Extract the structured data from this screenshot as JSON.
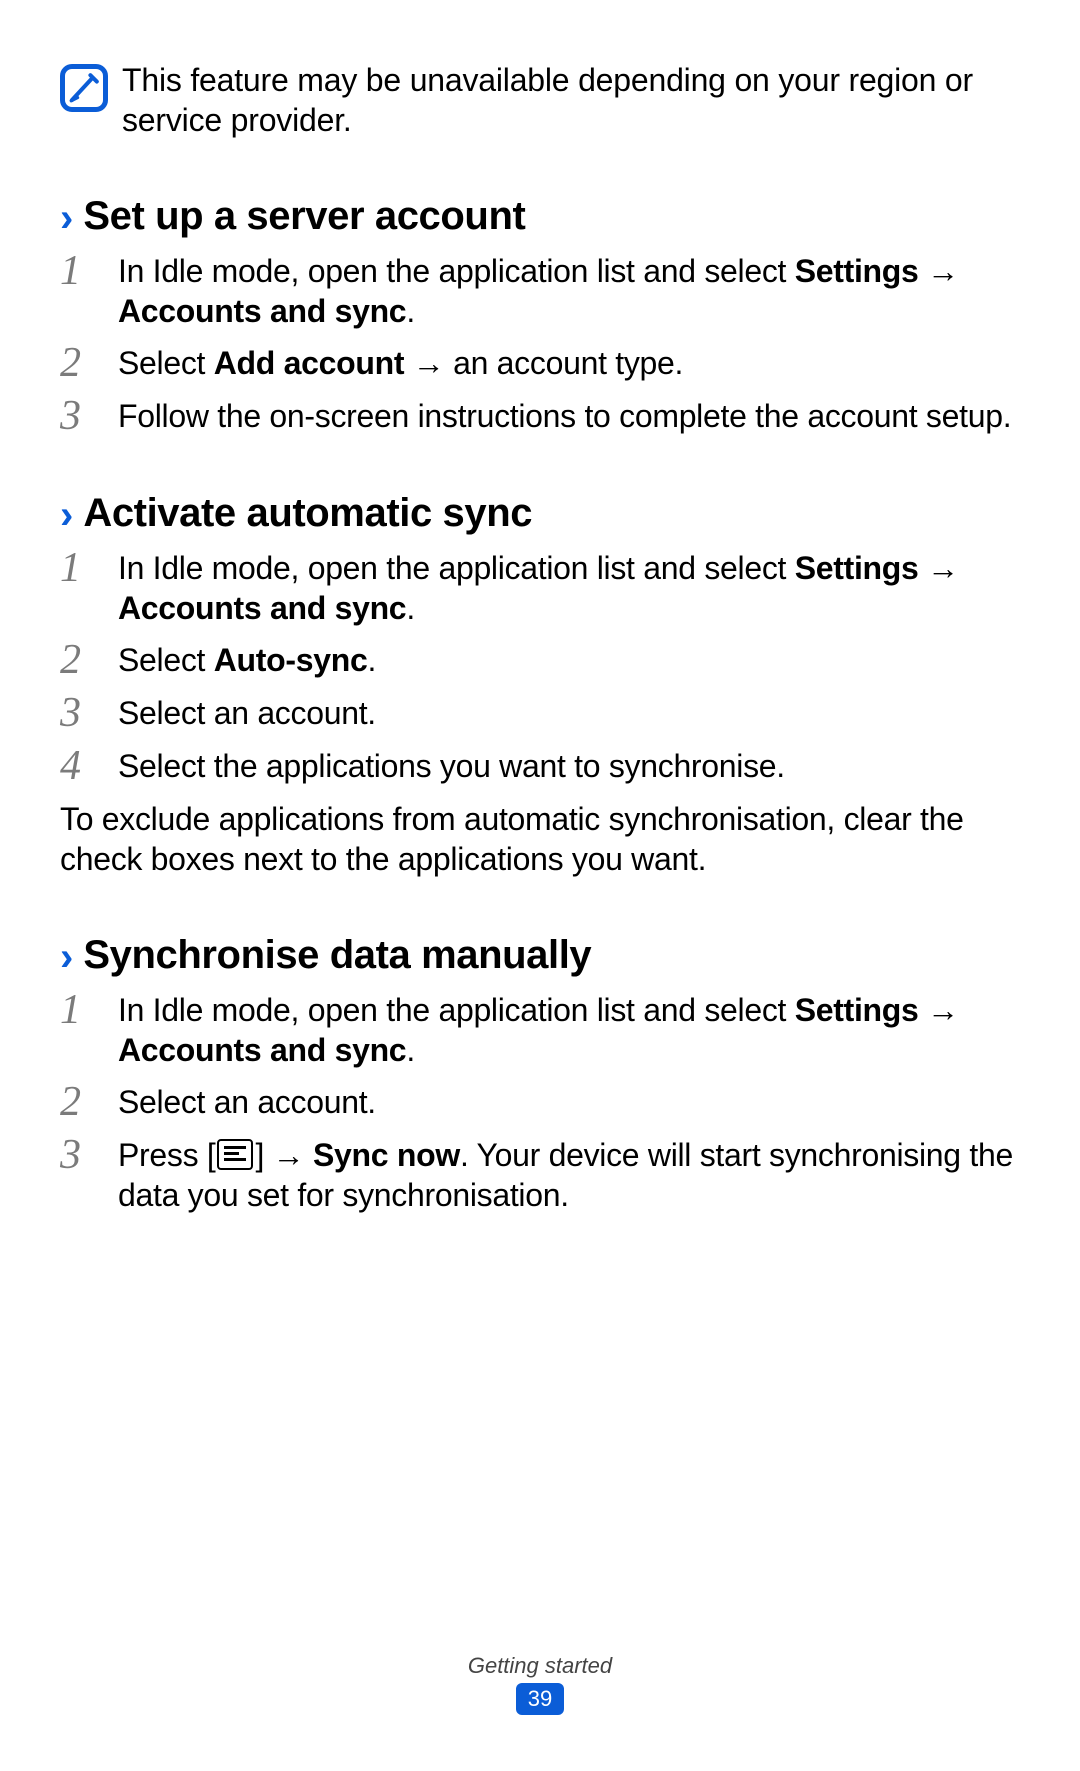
{
  "note": "This feature may be unavailable depending on your region or service provider.",
  "sections": [
    {
      "title": "Set up a server account",
      "steps": [
        {
          "html": "s0_0"
        },
        {
          "html": "s0_1"
        },
        {
          "html": "s0_2"
        }
      ]
    },
    {
      "title": "Activate automatic sync",
      "steps": [
        {
          "html": "s1_0"
        },
        {
          "html": "s1_1"
        },
        {
          "html": "s1_2"
        },
        {
          "html": "s1_3"
        }
      ],
      "post": "To exclude applications from automatic synchronisation, clear the check boxes next to the applications you want."
    },
    {
      "title": "Synchronise data manually",
      "steps": [
        {
          "html": "s2_0"
        },
        {
          "html": "s2_1"
        },
        {
          "html": "s2_2"
        }
      ]
    }
  ],
  "strings": {
    "s0_0_pre": "In Idle mode, open the application list and select ",
    "bold_settings": "Settings",
    "arrow": " → ",
    "bold_accounts": "Accounts and sync",
    "period": ".",
    "s0_1_a": "Select ",
    "s0_1_b": "Add account",
    "s0_1_c": " → an account type.",
    "s0_2": "Follow the on-screen instructions to complete the account setup.",
    "s1_1_a": "Select ",
    "s1_1_b": "Auto-sync",
    "s1_2": "Select an account.",
    "s1_3": "Select the applications you want to synchronise.",
    "s2_1": "Select an account.",
    "s2_2_a": "Press [",
    "s2_2_b": "] → ",
    "s2_2_c": "Sync now",
    "s2_2_d": ". Your device will start synchronising the data you set for synchronisation."
  },
  "footer": {
    "label": "Getting started",
    "page": "39"
  },
  "chart_data": null
}
